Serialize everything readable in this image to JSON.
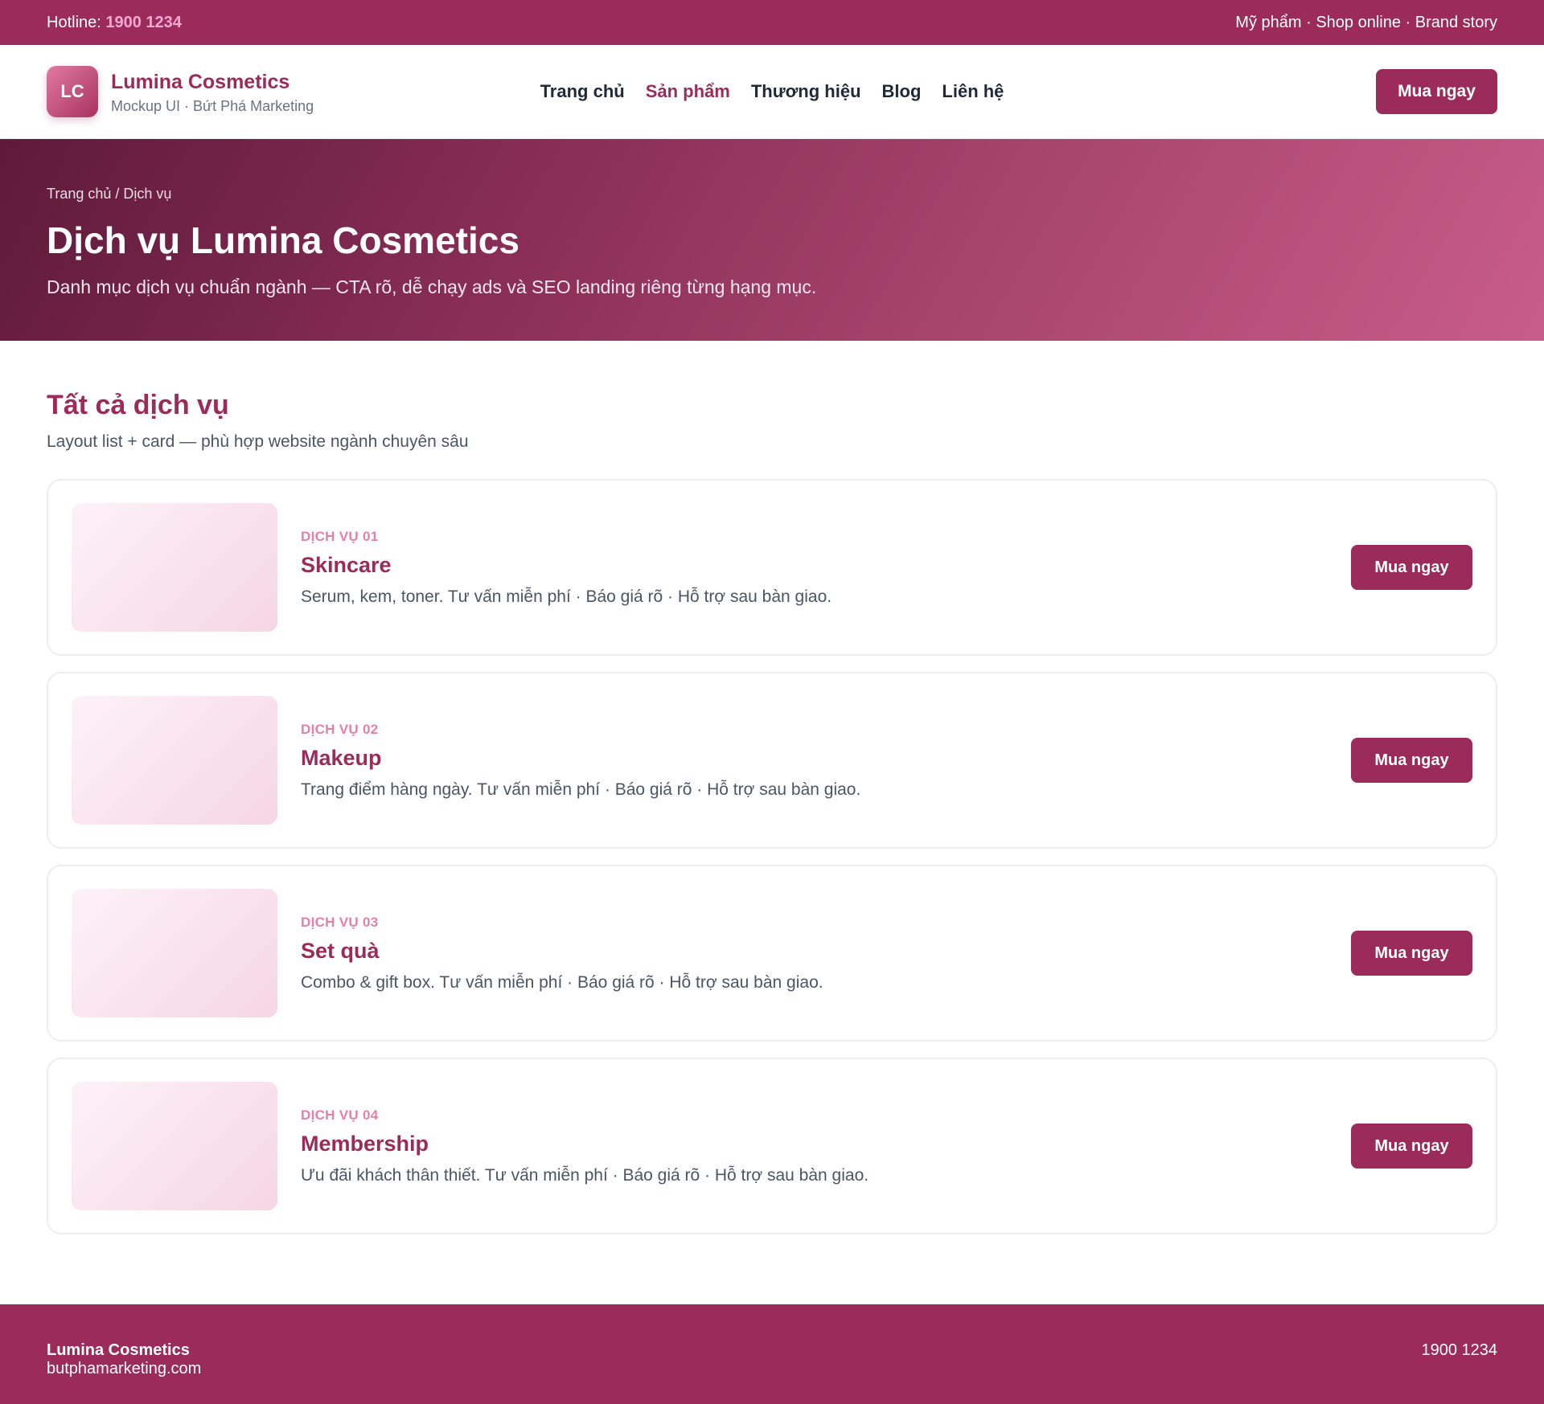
{
  "topbar": {
    "hotline_label": "Hotline: ",
    "hotline_number": "1900 1234",
    "links": "Mỹ phẩm · Shop online · Brand story"
  },
  "header": {
    "logo_initials": "LC",
    "brand_name": "Lumina Cosmetics",
    "brand_sub": "Mockup UI · Bứt Phá Marketing",
    "nav": [
      {
        "label": "Trang chủ"
      },
      {
        "label": "Sản phẩm"
      },
      {
        "label": "Thương hiệu"
      },
      {
        "label": "Blog"
      },
      {
        "label": "Liên hệ"
      }
    ],
    "cta_label": "Mua ngay"
  },
  "hero": {
    "breadcrumb": "Trang chủ / Dịch vụ",
    "title": "Dịch vụ Lumina Cosmetics",
    "subtitle": "Danh mục dịch vụ chuẩn ngành — CTA rõ, dễ chạy ads và SEO landing riêng từng hạng mục."
  },
  "services": {
    "title": "Tất cả dịch vụ",
    "subtitle": "Layout list + card — phù hợp website ngành chuyên sâu",
    "items": [
      {
        "tag": "DỊCH VỤ 01",
        "title": "Skincare",
        "desc": "Serum, kem, toner. Tư vấn miễn phí · Báo giá rõ · Hỗ trợ sau bàn giao.",
        "cta": "Mua ngay"
      },
      {
        "tag": "DỊCH VỤ 02",
        "title": "Makeup",
        "desc": "Trang điểm hàng ngày. Tư vấn miễn phí · Báo giá rõ · Hỗ trợ sau bàn giao.",
        "cta": "Mua ngay"
      },
      {
        "tag": "DỊCH VỤ 03",
        "title": "Set quà",
        "desc": "Combo & gift box. Tư vấn miễn phí · Báo giá rõ · Hỗ trợ sau bàn giao.",
        "cta": "Mua ngay"
      },
      {
        "tag": "DỊCH VỤ 04",
        "title": "Membership",
        "desc": "Ưu đãi khách thân thiết. Tư vấn miễn phí · Báo giá rõ · Hỗ trợ sau bàn giao.",
        "cta": "Mua ngay"
      }
    ]
  },
  "footer": {
    "brand": "Lumina Cosmetics",
    "domain": "butphamarketing.com",
    "phone": "1900 1234"
  },
  "colors": {
    "brand": "#9a2b5a",
    "accent_pink": "#f9a8d4",
    "tag_pink": "#e47fa9"
  }
}
